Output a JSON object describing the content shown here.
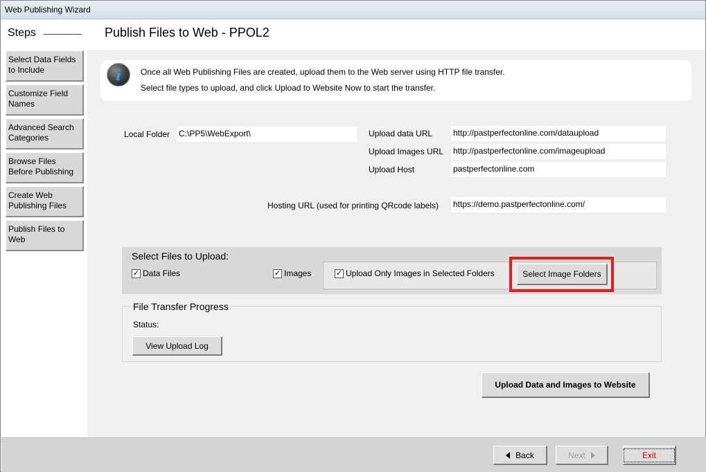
{
  "window": {
    "title": "Web Publishing Wizard"
  },
  "sidebar": {
    "heading": "Steps",
    "items": [
      {
        "label": "Select Data Fields to Include"
      },
      {
        "label": "Customize Field Names"
      },
      {
        "label": "Advanced Search Categories"
      },
      {
        "label": "Browse Files Before Publishing"
      },
      {
        "label": "Create Web Publishing Files"
      },
      {
        "label": "Publish Files to Web"
      }
    ]
  },
  "main": {
    "title": "Publish Files to Web - PPOL2",
    "info": {
      "icon": "info-icon",
      "line1": "Once all Web Publishing Files are created, upload them to the Web server using HTTP file transfer.",
      "line2": "Select file types to upload, and click Upload to Website Now to start the transfer."
    },
    "local_folder": {
      "label": "Local Folder",
      "value": "C:\\PP5\\WebExport\\"
    },
    "upload_data_url": {
      "label": "Upload data URL",
      "value": "http://pastperfectonline.com/dataupload"
    },
    "upload_images_url": {
      "label": "Upload Images URL",
      "value": "http://pastperfectonline.com/imageupload"
    },
    "upload_host": {
      "label": "Upload Host",
      "value": "pastperfectonline.com"
    },
    "hosting_url": {
      "label": "Hosting URL (used for printing QRcode labels)",
      "value": "https://demo.pastperfectonline.com/"
    },
    "select_files": {
      "title": "Select Files to Upload:",
      "data_files": {
        "label": "Data Files",
        "checked": true
      },
      "images": {
        "label": "Images",
        "checked": true
      },
      "only_selected": {
        "label": "Upload Only Images in Selected Folders",
        "checked": true
      },
      "select_folders_button": "Select Image Folders",
      "highlight_color": "#e02020"
    },
    "progress": {
      "title": "File Transfer Progress",
      "status_label": "Status:",
      "view_log_button": "View Upload Log"
    },
    "upload_button": "Upload Data and Images to Website"
  },
  "footer": {
    "back": "Back",
    "next": "Next",
    "exit": "Exit",
    "exit_color": "#d00000"
  }
}
